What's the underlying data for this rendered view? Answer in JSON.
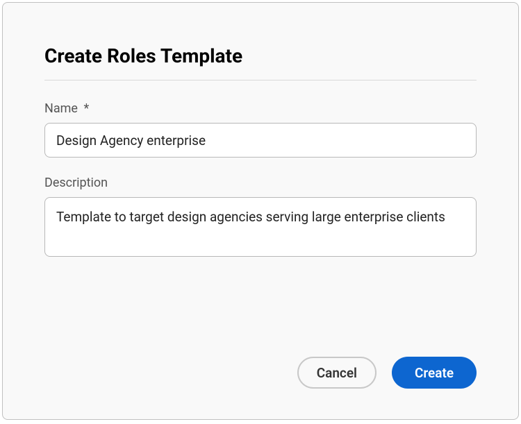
{
  "dialog": {
    "title": "Create Roles Template",
    "fields": {
      "name": {
        "label": "Name",
        "required_mark": "*",
        "value": "Design Agency enterprise"
      },
      "description": {
        "label": "Description",
        "value": "Template to target design agencies serving large enterprise clients"
      }
    },
    "buttons": {
      "cancel": "Cancel",
      "create": "Create"
    }
  }
}
